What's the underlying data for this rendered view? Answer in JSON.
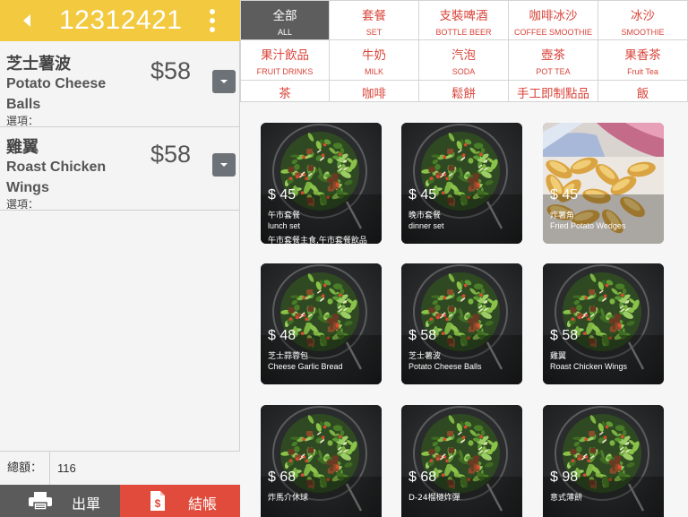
{
  "order": {
    "number": "12312421",
    "items": [
      {
        "name_zh": "芝士薯波",
        "name_en": "Potato Cheese Balls",
        "price": "$58",
        "options_label": "選項："
      },
      {
        "name_zh": "雞翼",
        "name_en": "Roast Chicken Wings",
        "price": "$58",
        "options_label": "選項："
      }
    ],
    "total_label": "總額：",
    "total_value": "116"
  },
  "actions": {
    "print_label": "出單",
    "checkout_label": "結帳"
  },
  "categories": [
    {
      "zh": "全部",
      "en": "ALL",
      "active": true
    },
    {
      "zh": "套餐",
      "en": "SET"
    },
    {
      "zh": "支裝啤酒",
      "en": "BOTTLE BEER"
    },
    {
      "zh": "咖啡冰沙",
      "en": "COFFEE SMOOTHIE"
    },
    {
      "zh": "冰沙",
      "en": "SMOOTHIE"
    },
    {
      "zh": "果汁飲品",
      "en": "FRUIT DRINKS"
    },
    {
      "zh": "牛奶",
      "en": "MILK"
    },
    {
      "zh": "汽泡",
      "en": "SODA"
    },
    {
      "zh": "壺茶",
      "en": "POT TEA"
    },
    {
      "zh": "果香茶",
      "en": "Fruit Tea"
    },
    {
      "zh": "茶",
      "en": ""
    },
    {
      "zh": "咖啡",
      "en": ""
    },
    {
      "zh": "鬆餅",
      "en": ""
    },
    {
      "zh": "手工即制點品",
      "en": ""
    },
    {
      "zh": "飯",
      "en": ""
    }
  ],
  "products": [
    {
      "price": "$ 45",
      "name_zh": "午市套餐",
      "name_en": "lunch set",
      "extra": "午市套餐主食,午市套餐飲品",
      "image": "salad"
    },
    {
      "price": "$ 45",
      "name_zh": "晚市套餐",
      "name_en": "dinner set",
      "extra": "",
      "image": "salad"
    },
    {
      "price": "$ 45",
      "name_zh": "炸薯角",
      "name_en": "Fried Potato Wedges",
      "extra": "",
      "image": "wedges"
    },
    {
      "price": "$ 48",
      "name_zh": "芝士蒜蓉包",
      "name_en": "Cheese Garlic Bread",
      "extra": "",
      "image": "salad"
    },
    {
      "price": "$ 58",
      "name_zh": "芝士薯波",
      "name_en": "Potato Cheese Balls",
      "extra": "",
      "image": "salad"
    },
    {
      "price": "$ 58",
      "name_zh": "雞翼",
      "name_en": "Roast Chicken Wings",
      "extra": "",
      "image": "salad"
    },
    {
      "price": "$ 68",
      "name_zh": "炸馬介休球",
      "name_en": "",
      "extra": "",
      "image": "salad"
    },
    {
      "price": "$ 68",
      "name_zh": "D-24榴槤炸彈",
      "name_en": "",
      "extra": "",
      "image": "salad"
    },
    {
      "price": "$ 98",
      "name_zh": "意式薄餅",
      "name_en": "",
      "extra": "",
      "image": "salad"
    }
  ],
  "colors": {
    "header": "#f3c93f",
    "accent_red": "#d9443a",
    "checkout": "#e04b3b",
    "print": "#5b5b5b",
    "active_tab": "#5d5d5d"
  },
  "icons": {
    "back": "chevron-left-icon",
    "more": "kebab-menu-icon",
    "dropdown": "caret-down-icon",
    "print": "printer-icon",
    "checkout": "dollar-document-icon"
  }
}
